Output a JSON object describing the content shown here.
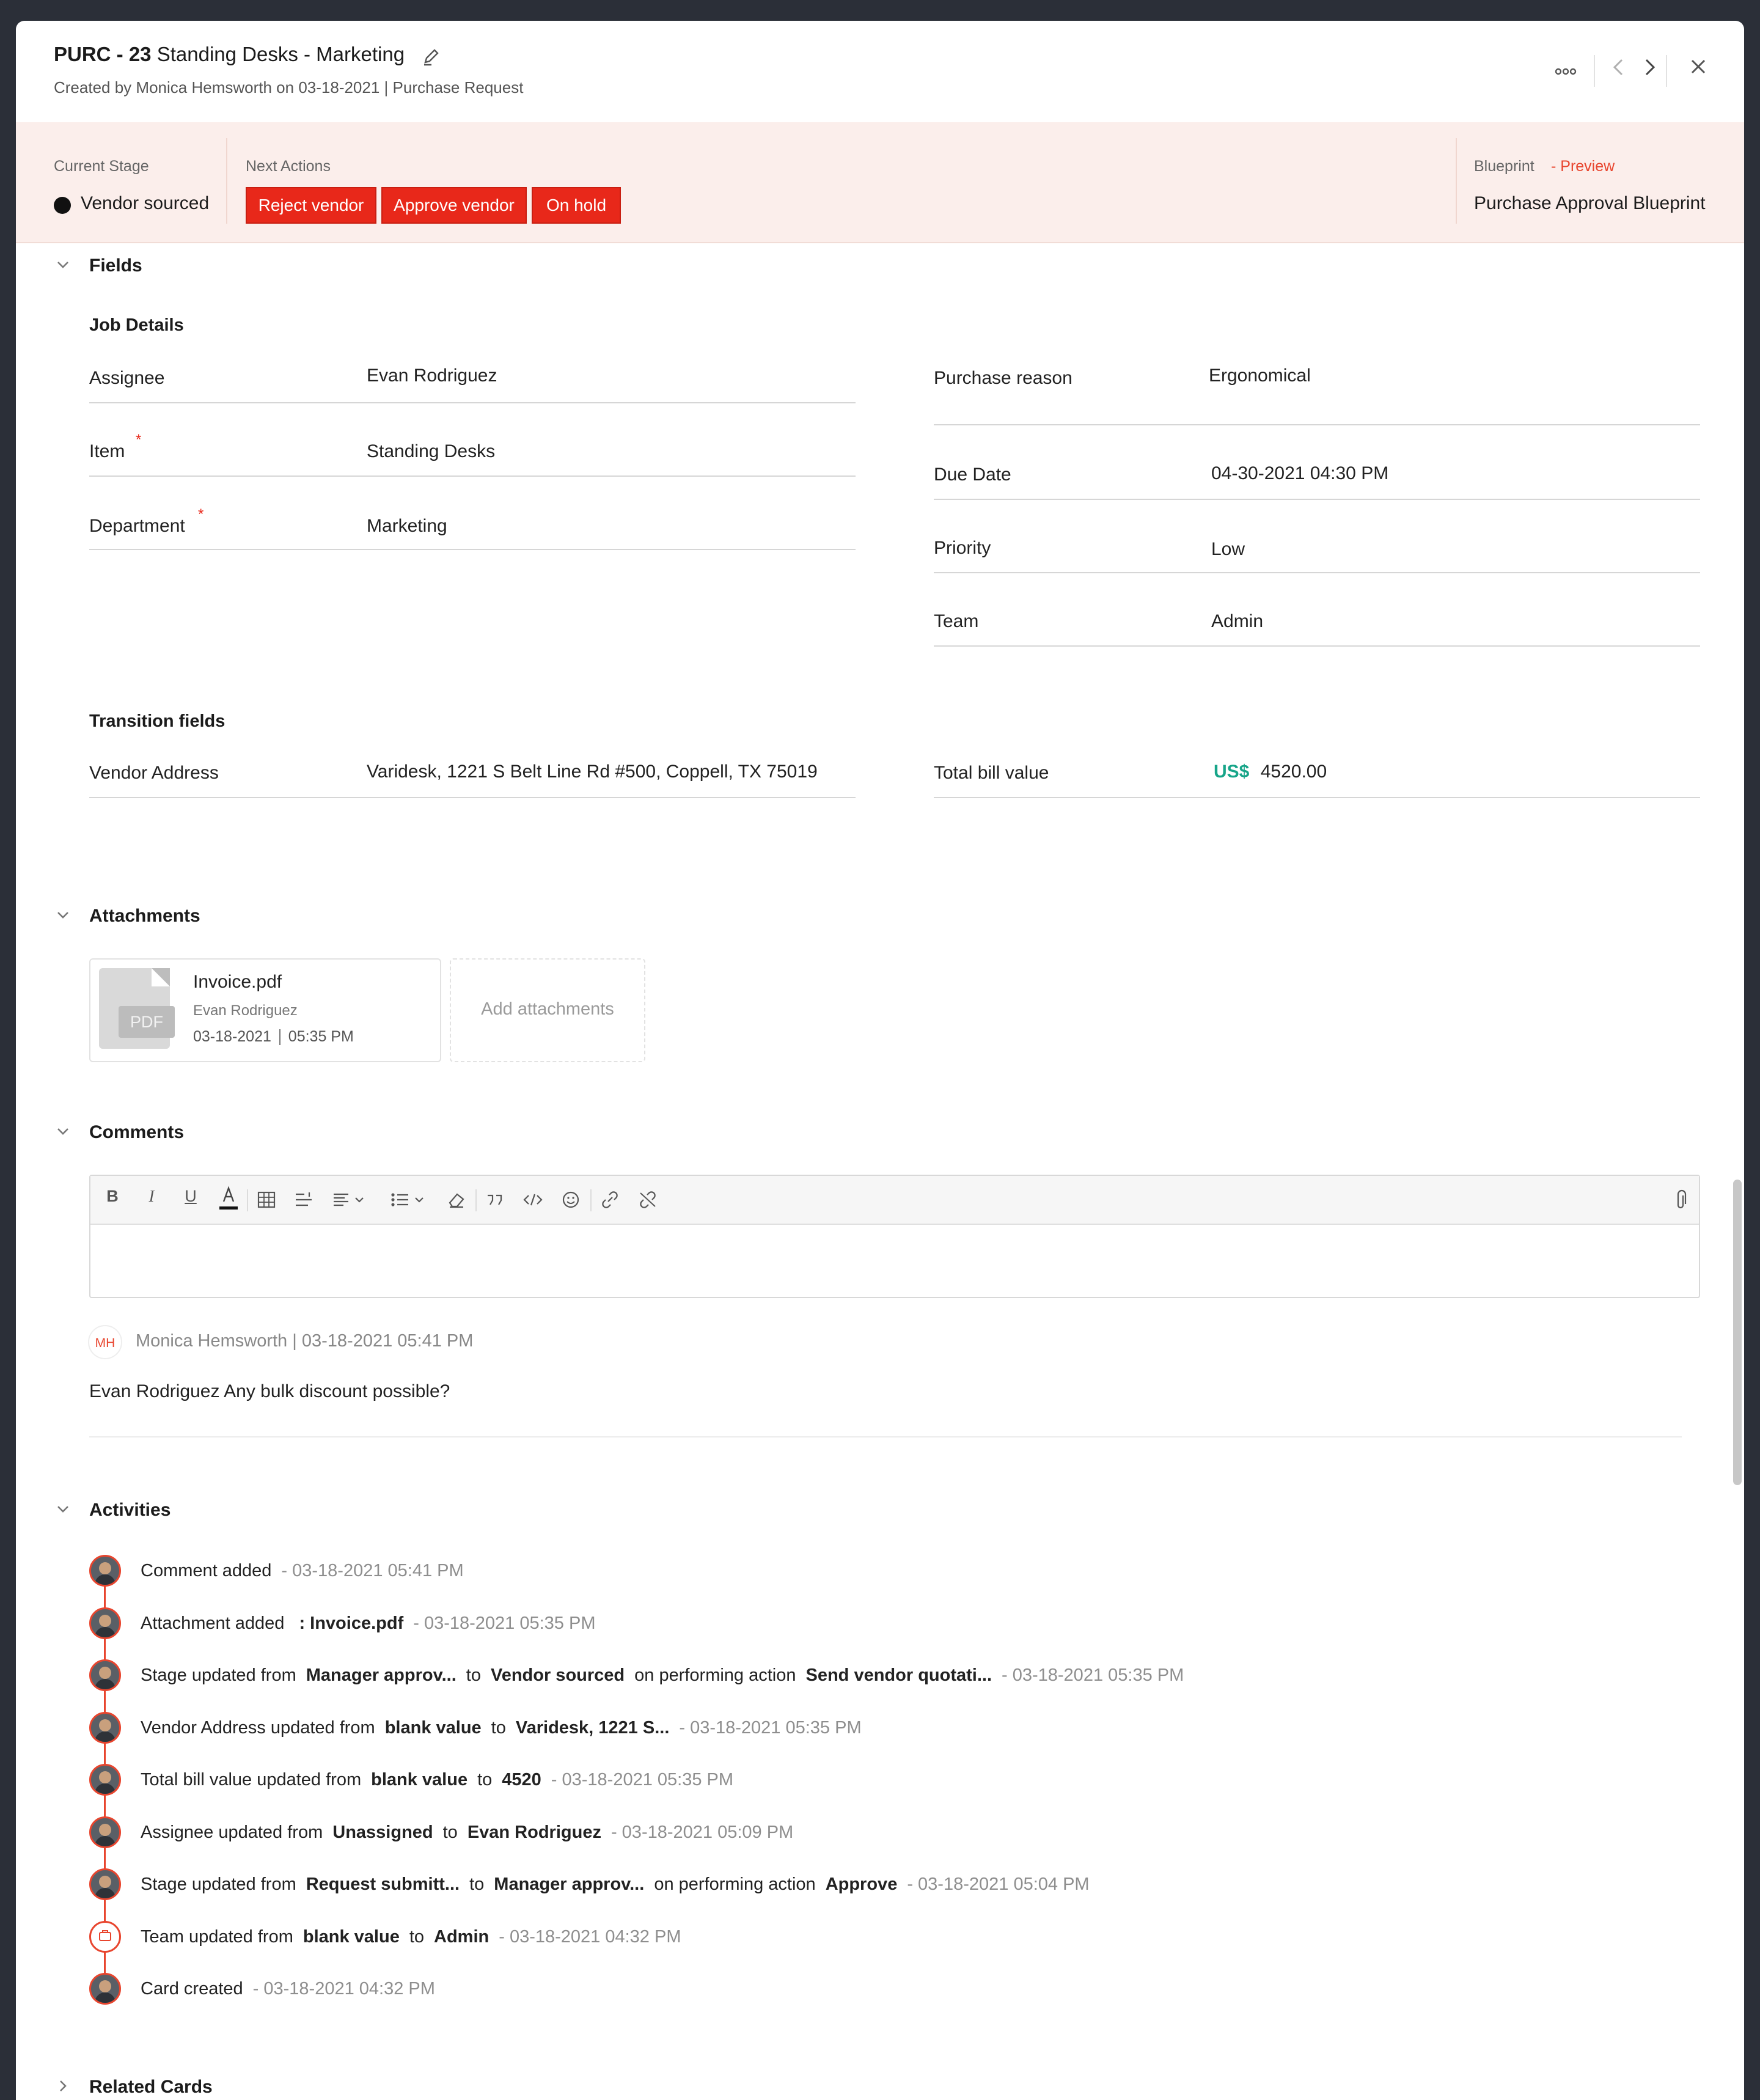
{
  "header": {
    "id": "PURC - 23",
    "title": "Standing Desks - Marketing",
    "created_by_prefix": "Created by",
    "created_by": "Monica Hemsworth",
    "created_on": "on 03-18-2021",
    "type": "| Purchase Request"
  },
  "stage": {
    "current_stage_label": "Current Stage",
    "current_stage": "Vendor sourced",
    "next_actions_label": "Next Actions",
    "actions": [
      "Reject vendor",
      "Approve vendor",
      "On hold"
    ],
    "blueprint_label": "Blueprint",
    "blueprint_preview": "- Preview",
    "blueprint_name": "Purchase Approval Blueprint"
  },
  "fields": {
    "section_title": "Fields",
    "job_details_title": "Job Details",
    "left": [
      {
        "label": "Assignee",
        "value": "Evan Rodriguez"
      },
      {
        "label": "Item",
        "value": "Standing Desks",
        "required": "*"
      },
      {
        "label": "Department",
        "value": "Marketing",
        "required": "*"
      }
    ],
    "right": [
      {
        "label": "Purchase reason",
        "value": "Ergonomical"
      },
      {
        "label": "Due Date",
        "value": "04-30-2021 04:30 PM"
      },
      {
        "label": "Priority",
        "value": "Low"
      },
      {
        "label": "Team",
        "value": "Admin"
      }
    ],
    "transition_title": "Transition fields",
    "vendor_address_label": "Vendor Address",
    "vendor_address_value": "Varidesk, 1221 S Belt Line Rd #500, Coppell, TX 75019",
    "total_bill_label": "Total bill value",
    "total_bill_currency": "US$",
    "total_bill_value": "4520.00"
  },
  "attachments": {
    "section_title": "Attachments",
    "file_name": "Invoice.pdf",
    "file_owner": "Evan Rodriguez",
    "file_date": "03-18-2021",
    "file_time": "05:35 PM",
    "file_badge": "PDF",
    "add_label": "Add attachments"
  },
  "comments": {
    "section_title": "Comments",
    "toolbar_icons": [
      "bold-icon",
      "italic-icon",
      "underline-icon",
      "text-color-icon",
      "table-icon",
      "line-spacing-icon",
      "align-icon",
      "list-icon",
      "clear-format-icon",
      "quote-icon",
      "code-icon",
      "emoji-icon",
      "link-icon",
      "unlink-icon",
      "attach-icon"
    ],
    "items": [
      {
        "initials": "MH",
        "author": "Monica Hemsworth",
        "separator": "|",
        "time": "03-18-2021 05:41 PM",
        "text": "Evan Rodriguez Any bulk discount possible?"
      }
    ]
  },
  "activities": {
    "section_title": "Activities",
    "items": [
      {
        "parts": [
          [
            "Comment added",
            "n"
          ]
        ],
        "time": "- 03-18-2021 05:41 PM"
      },
      {
        "parts": [
          [
            "Attachment added",
            "n"
          ],
          [
            " : Invoice.pdf",
            "b"
          ]
        ],
        "time": "- 03-18-2021 05:35 PM"
      },
      {
        "parts": [
          [
            "Stage updated from",
            "n"
          ],
          [
            "Manager approv...",
            "b"
          ],
          [
            "to",
            "n"
          ],
          [
            "Vendor sourced",
            "b"
          ],
          [
            "on performing action",
            "n"
          ],
          [
            "Send vendor quotati...",
            "b"
          ]
        ],
        "time": "- 03-18-2021 05:35 PM"
      },
      {
        "parts": [
          [
            "Vendor Address updated from",
            "n"
          ],
          [
            "blank value",
            "b"
          ],
          [
            "to",
            "n"
          ],
          [
            "Varidesk, 1221 S...",
            "b"
          ]
        ],
        "time": "- 03-18-2021 05:35 PM"
      },
      {
        "parts": [
          [
            "Total bill value updated from",
            "n"
          ],
          [
            "blank value",
            "b"
          ],
          [
            "to",
            "n"
          ],
          [
            "4520",
            "b"
          ]
        ],
        "time": "- 03-18-2021 05:35 PM"
      },
      {
        "parts": [
          [
            "Assignee updated from",
            "n"
          ],
          [
            "Unassigned",
            "b"
          ],
          [
            "to",
            "n"
          ],
          [
            "Evan Rodriguez",
            "b"
          ]
        ],
        "time": "- 03-18-2021 05:09 PM"
      },
      {
        "parts": [
          [
            "Stage updated from",
            "n"
          ],
          [
            "Request submitt...",
            "b"
          ],
          [
            "to",
            "n"
          ],
          [
            "Manager approv...",
            "b"
          ],
          [
            "on performing action",
            "n"
          ],
          [
            "Approve",
            "b"
          ]
        ],
        "time": "- 03-18-2021 05:04 PM"
      },
      {
        "parts": [
          [
            "Team updated from",
            "n"
          ],
          [
            "blank value",
            "b"
          ],
          [
            "to",
            "n"
          ],
          [
            "Admin",
            "b"
          ]
        ],
        "time": "- 03-18-2021 04:32 PM",
        "system": true
      },
      {
        "parts": [
          [
            "Card created",
            "n"
          ]
        ],
        "time": "- 03-18-2021 04:32 PM"
      }
    ]
  },
  "related_cards": {
    "section_title": "Related Cards"
  }
}
